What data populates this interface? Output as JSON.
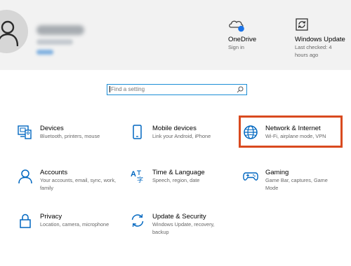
{
  "header": {
    "onedrive": {
      "title": "OneDrive",
      "status": "Sign in"
    },
    "windows_update": {
      "title": "Windows Update",
      "status": "Last checked: 4 hours ago"
    }
  },
  "search": {
    "placeholder": "Find a setting"
  },
  "tiles": [
    {
      "title": "Devices",
      "desc": "Bluetooth, printers, mouse",
      "icon": "devices-icon"
    },
    {
      "title": "Mobile devices",
      "desc": "Link your Android, iPhone",
      "icon": "phone-icon"
    },
    {
      "title": "Network & Internet",
      "desc": "Wi-Fi, airplane mode, VPN",
      "icon": "globe-icon"
    },
    {
      "title": "Accounts",
      "desc": "Your accounts, email, sync, work, family",
      "icon": "person-icon"
    },
    {
      "title": "Time & Language",
      "desc": "Speech, region, date",
      "icon": "time-language-icon"
    },
    {
      "title": "Gaming",
      "desc": "Game Bar, captures, Game Mode",
      "icon": "gamepad-icon"
    },
    {
      "title": "Privacy",
      "desc": "Location, camera, microphone",
      "icon": "lock-icon"
    },
    {
      "title": "Update & Security",
      "desc": "Windows Update, recovery, backup",
      "icon": "sync-icon"
    }
  ],
  "colors": {
    "accent": "#0067c0",
    "highlight": "#d94a1f",
    "search_border": "#1c8ed6"
  }
}
